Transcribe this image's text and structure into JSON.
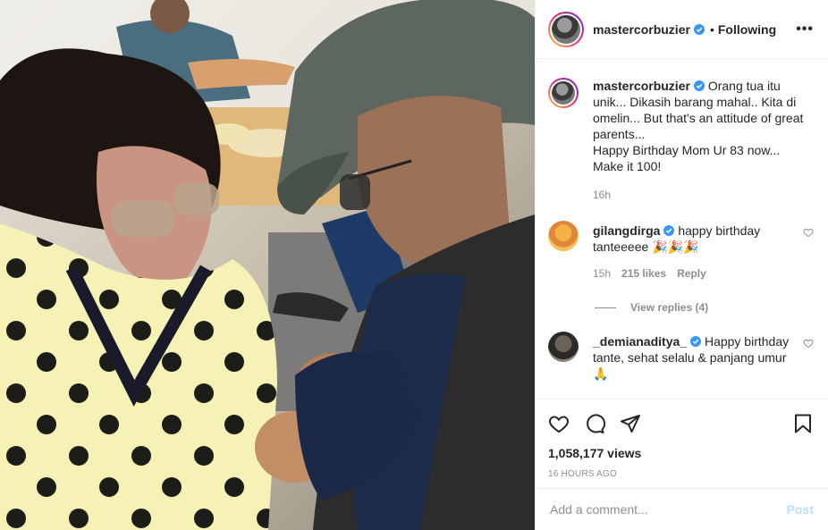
{
  "header": {
    "username": "mastercorbuzier",
    "following_label": "Following",
    "more_label": "•••"
  },
  "caption": {
    "username": "mastercorbuzier",
    "text": "Orang tua itu unik... Dikasih barang mahal.. Kita di omelin... But that's an attitude of great parents...\nHappy Birthday Mom Ur 83 now...\nMake it 100!",
    "time": "16h"
  },
  "comments": [
    {
      "username": "gilangdirga",
      "text": "happy birthday tanteeeee 🎉🎉🎉",
      "time": "15h",
      "likes": "215 likes",
      "reply_label": "Reply",
      "view_replies": "View replies (4)"
    },
    {
      "username": "_demianaditya_",
      "text": "Happy birthday tante, sehat selalu & panjang umur 🙏"
    }
  ],
  "stats": {
    "views": "1,058,177 views",
    "posted": "16 HOURS AGO"
  },
  "add_comment": {
    "placeholder": "Add a comment...",
    "post_label": "Post"
  },
  "colors": {
    "verified": "#3897f0",
    "post_disabled": "#b2dffc",
    "muted": "#8e8e8e"
  }
}
